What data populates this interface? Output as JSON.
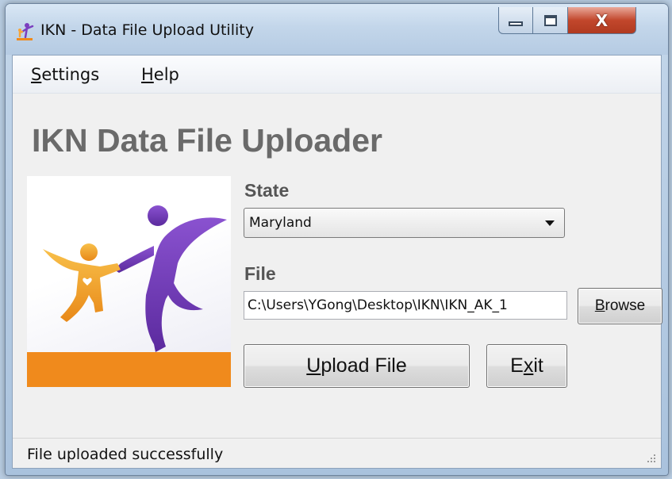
{
  "window": {
    "title": "IKN - Data File Upload Utility",
    "controls": {
      "minimize_icon": "minimize-icon",
      "maximize_icon": "maximize-icon",
      "close_label": "X"
    }
  },
  "menu": {
    "settings": {
      "accel": "S",
      "rest": "ettings"
    },
    "help": {
      "accel": "H",
      "rest": "elp"
    }
  },
  "app": {
    "heading": "IKN Data File Uploader",
    "logo_icon": "ikn-family-logo",
    "colors": {
      "purple": "#7b3fbf",
      "orange": "#f08a1c",
      "yellow": "#f6b53a",
      "heading_gray": "#6a6a6a"
    }
  },
  "form": {
    "state_label": "State",
    "state_value": "Maryland",
    "file_label": "File",
    "file_value": "C:\\Users\\YGong\\Desktop\\IKN\\IKN_AK_1",
    "browse": {
      "accel": "B",
      "rest": "rowse"
    },
    "upload": {
      "accel": "U",
      "rest": "pload File"
    },
    "exit": {
      "pre": "E",
      "accel": "x",
      "post": "it"
    }
  },
  "status": {
    "text": "File uploaded successfully"
  }
}
